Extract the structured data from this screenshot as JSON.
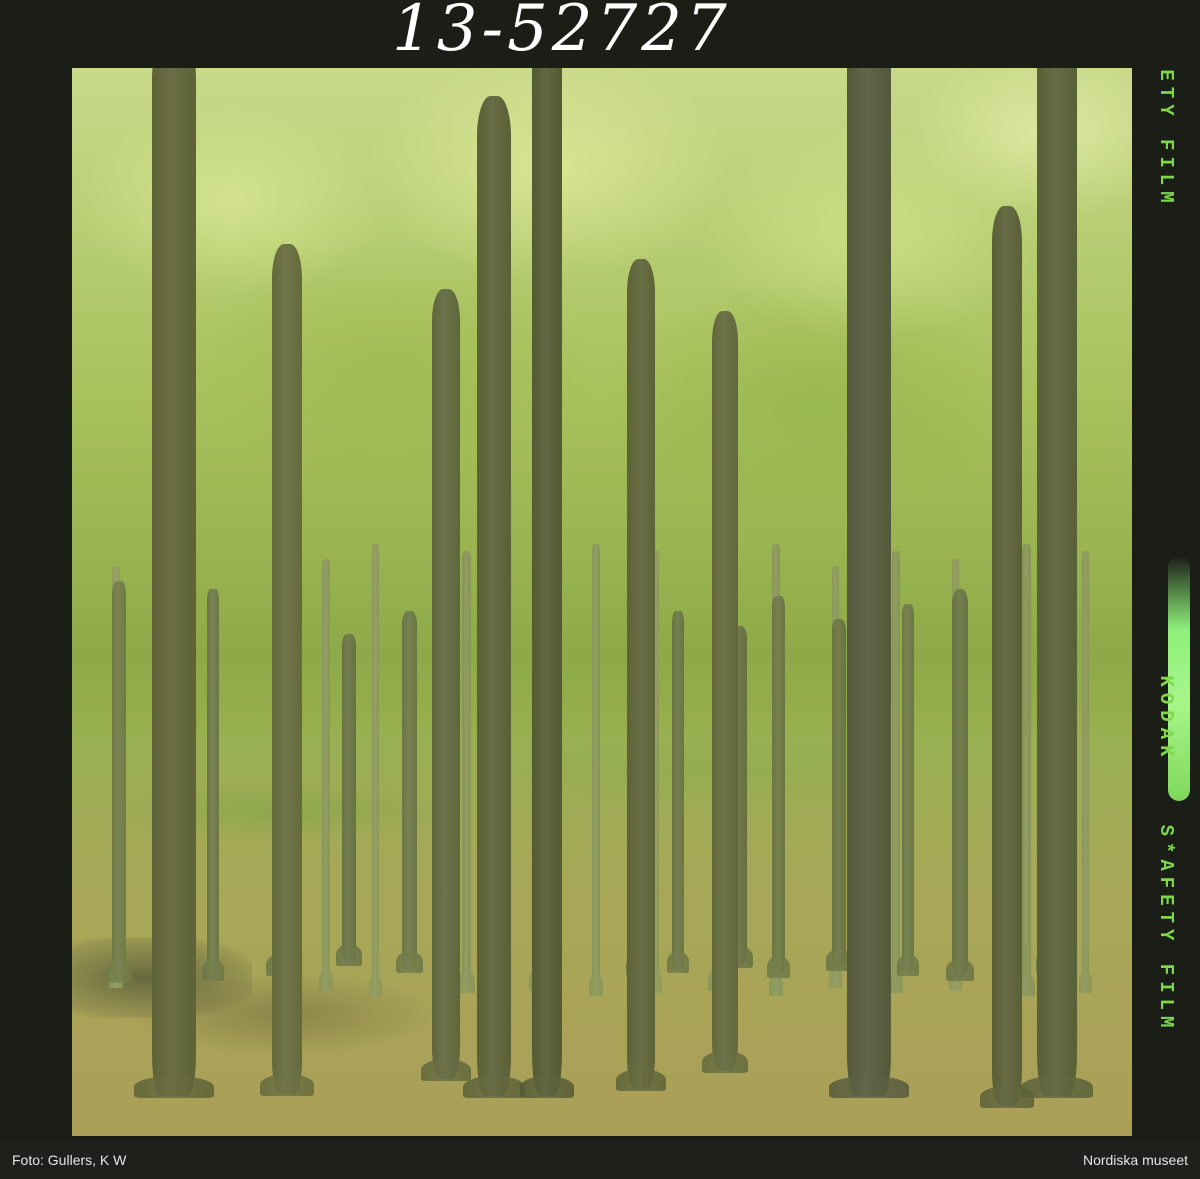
{
  "film": {
    "negative_number": "13-52727",
    "edge_markings": [
      "ETY FILM",
      "KODAK",
      "S*AFETY FILM"
    ]
  },
  "photo": {
    "subject": "",
    "colors": {
      "foliage_light": "#c8d98a",
      "foliage_mid": "#8eaa48",
      "trunk": "#5e6236",
      "ground": "#ab9f58"
    }
  },
  "footer": {
    "credit": "Foto: Gullers, K W",
    "museum": "Nordiska museet"
  }
}
